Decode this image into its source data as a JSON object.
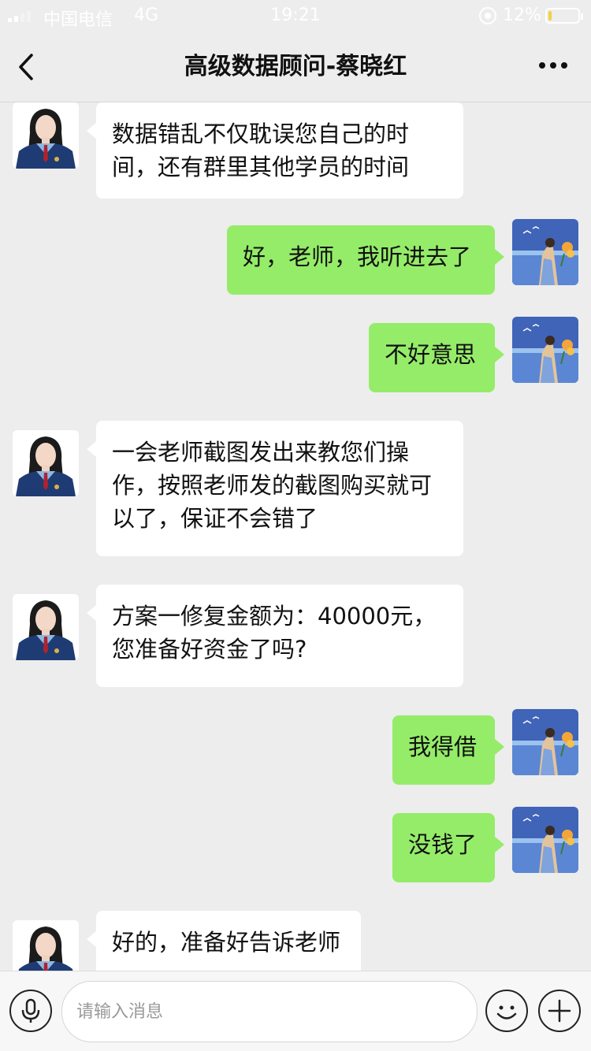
{
  "status_bar": {
    "carrier": "中国电信",
    "network": "4G",
    "time": "19:21",
    "battery_percent": "12%",
    "battery_level": 0.12,
    "battery_color": "#f2d23b"
  },
  "nav": {
    "title": "高级数据顾问-蔡晓红"
  },
  "messages": [
    {
      "side": "left",
      "text": "数据错乱不仅耽误您自己的时间，还有群里其他学员的时间"
    },
    {
      "side": "right",
      "text": "好，老师，我听进去了"
    },
    {
      "side": "right",
      "text": "不好意思"
    },
    {
      "side": "left",
      "text": "一会老师截图发出来教您们操作，按照老师发的截图购买就可以了，保证不会错了"
    },
    {
      "side": "left",
      "text": "方案一修复金额为：40000元，您准备好资金了吗?"
    },
    {
      "side": "right",
      "text": "我得借"
    },
    {
      "side": "right",
      "text": "没钱了"
    },
    {
      "side": "left",
      "text": "好的，准备好告诉老师"
    }
  ],
  "input": {
    "placeholder": "请输入消息"
  },
  "colors": {
    "background": "#ededed",
    "own_bubble": "#95ec69",
    "other_bubble": "#ffffff"
  }
}
